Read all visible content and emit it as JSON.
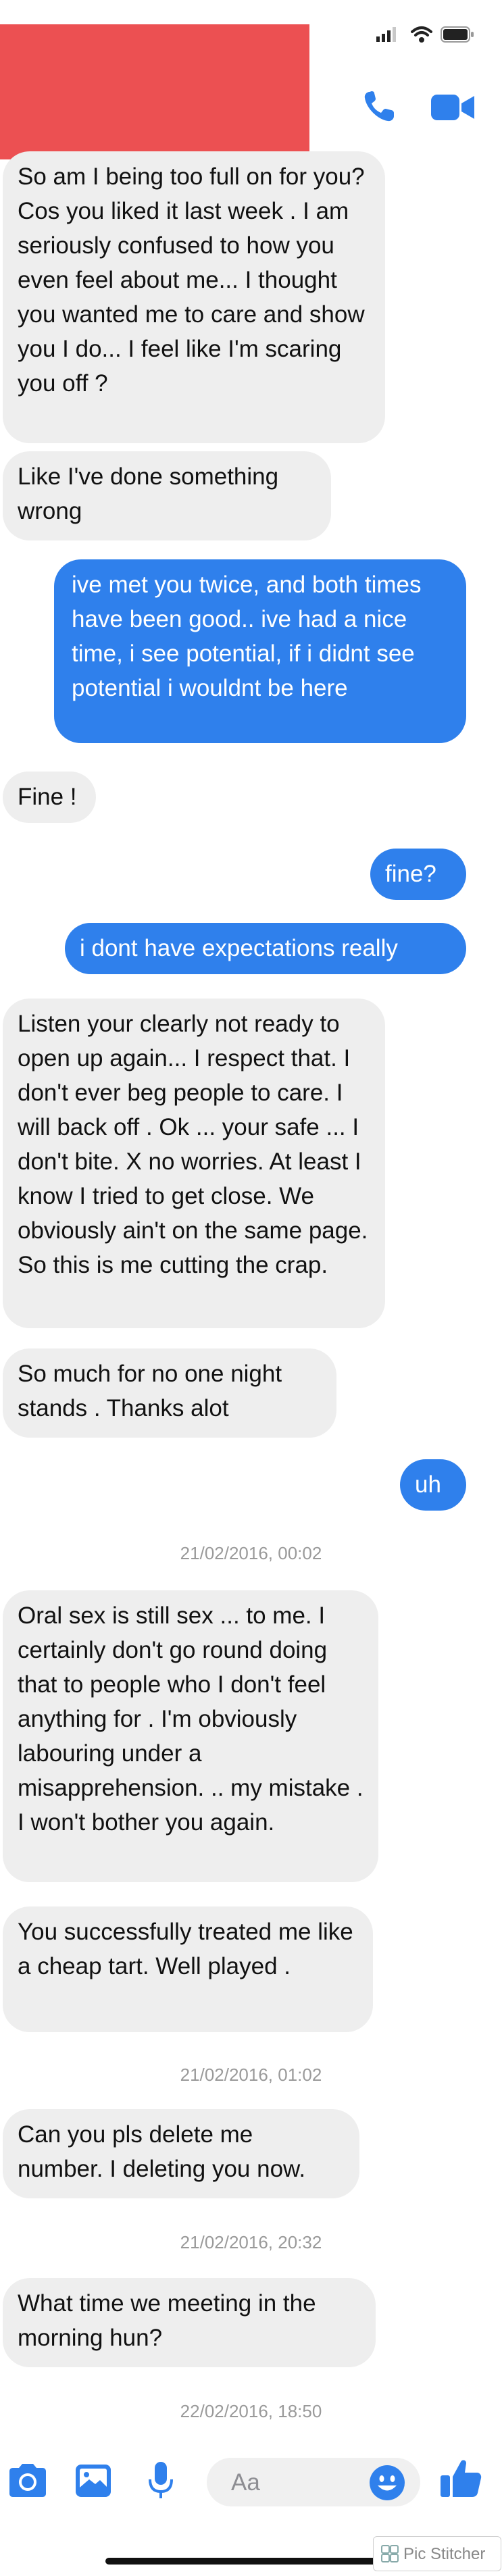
{
  "colors": {
    "redacted_header": "#ec5052",
    "incoming_bubble": "#eeeeee",
    "outgoing_bubble": "#2f80ec",
    "accent": "#2f80ec",
    "timestamp": "#9a9a9a"
  },
  "header": {
    "icons": [
      "signal-bars-icon",
      "wifi-icon",
      "battery-icon",
      "phone-icon",
      "video-camera-icon"
    ]
  },
  "messages": [
    {
      "from": "them",
      "text": "So am I being too full on for you? Cos you liked it last week . I am seriously confused to how you even feel about me... I thought you wanted me to care and show you I do... I feel like I'm scaring you off ?"
    },
    {
      "from": "them",
      "text": "Like I've done something wrong"
    },
    {
      "from": "me",
      "text": "ive met you twice, and both times have been good.. ive had a nice time, i see potential, if i didnt see potential i wouldnt be here"
    },
    {
      "from": "them",
      "text": "Fine !"
    },
    {
      "from": "me",
      "text": "fine?"
    },
    {
      "from": "me",
      "text": "i dont have expectations really"
    },
    {
      "from": "them",
      "text": "Listen your clearly not ready to open up again... I respect that.  I don't ever beg people to care. I will back off . Ok ... your safe ... I don't bite. X no worries. At least I know I tried to get close. We obviously ain't on the same page. So this is me cutting the crap."
    },
    {
      "from": "them",
      "text": "So much for no one night stands . Thanks alot"
    },
    {
      "from": "me",
      "text": "uh"
    },
    {
      "from": "them",
      "text": "Oral sex is still sex ... to me. I certainly don't go round doing that to people who I don't feel anything for . I'm obviously labouring under a misapprehension. .. my mistake . I won't bother you again."
    },
    {
      "from": "them",
      "text": "You successfully treated me like a cheap tart. Well played ."
    },
    {
      "from": "them",
      "text": "Can you pls delete me number. I deleting you now."
    },
    {
      "from": "them",
      "text": "What time we meeting in the morning hun?"
    }
  ],
  "timestamps": [
    "21/02/2016, 00:02",
    "21/02/2016, 01:02",
    "21/02/2016, 20:32",
    "22/02/2016, 18:50"
  ],
  "composer": {
    "placeholder": "Aa",
    "icons": [
      "camera-icon",
      "image-icon",
      "microphone-icon",
      "emoji-icon",
      "thumbs-up-icon"
    ]
  },
  "watermark": "Pic Stitcher"
}
